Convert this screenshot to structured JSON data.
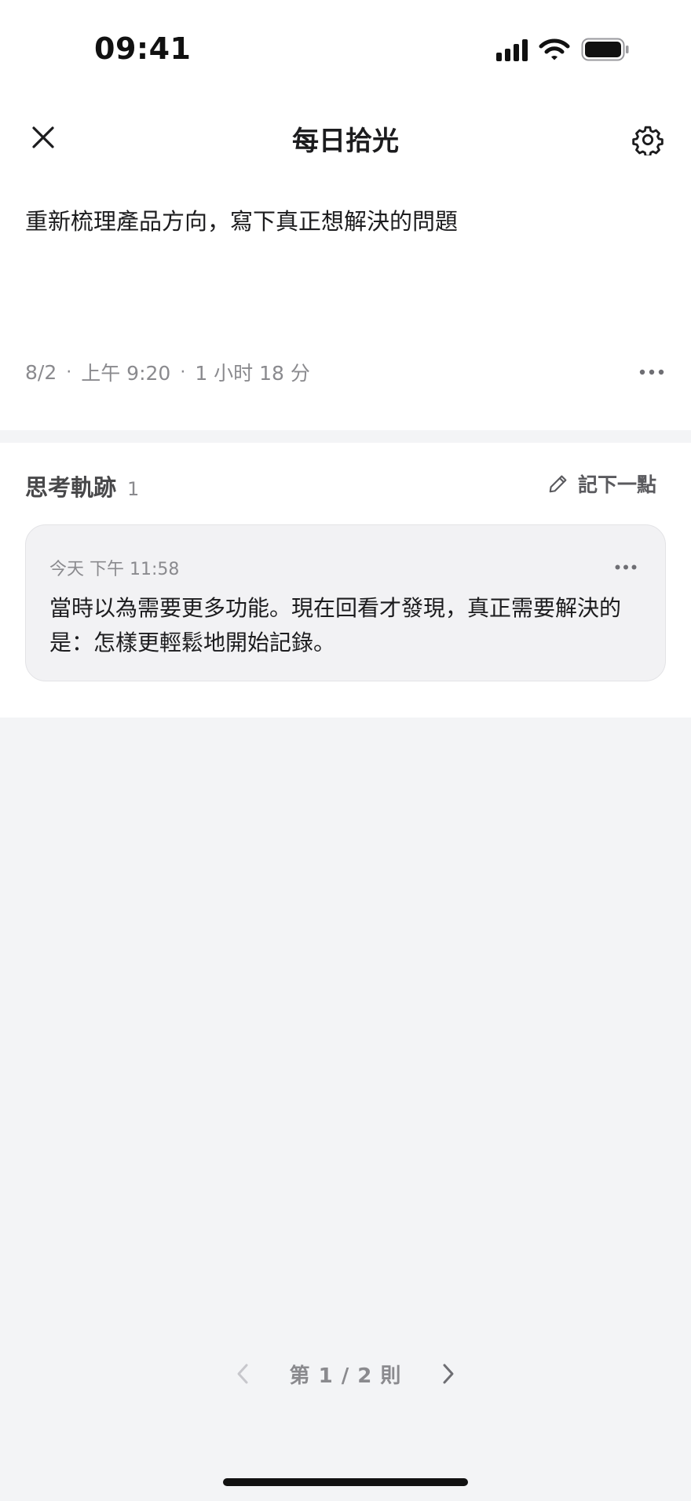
{
  "status_bar": {
    "time": "09:41",
    "icons": [
      "cellular-signal-icon",
      "wifi-icon",
      "battery-icon"
    ]
  },
  "nav": {
    "title": "每日拾光",
    "close_icon": "close-icon",
    "settings_icon": "gear-icon"
  },
  "entry": {
    "title": "重新梳理產品方向，寫下真正想解決的問題",
    "date": "8/2",
    "time": "上午 9:20",
    "duration": "1 小时 18 分",
    "separator": "·"
  },
  "thoughts": {
    "title": "思考軌跡",
    "count": "1",
    "add_label": "記下一點",
    "items": [
      {
        "time": "今天 下午 11:58",
        "text": "當時以為需要更多功能。現在回看才發現，真正需要解決的是：怎樣更輕鬆地開始記錄。"
      }
    ]
  },
  "pager": {
    "label": "第 1 / 2 則"
  },
  "colors": {
    "background": "#f3f4f6",
    "card": "#f2f2f4",
    "text_primary": "#1c1c1e",
    "text_secondary": "#8a8a8e"
  }
}
